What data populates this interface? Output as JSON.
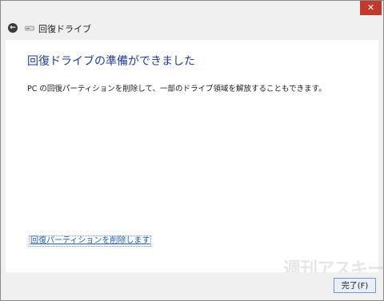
{
  "window": {
    "close_symbol": "✕"
  },
  "header": {
    "back_symbol": "←",
    "title": "回復ドライブ"
  },
  "main": {
    "heading": "回復ドライブの準備ができました",
    "description": "PC の回復パーティションを削除して、一部のドライブ領域を解放することもできます。",
    "delete_link": "回復パーティションを削除します"
  },
  "footer": {
    "finish_label": "完了(F)"
  },
  "watermark": {
    "text": "週刊アスキー"
  },
  "colors": {
    "heading": "#1e3d9a",
    "link": "#1e5fb0",
    "close": "#c0392b"
  }
}
